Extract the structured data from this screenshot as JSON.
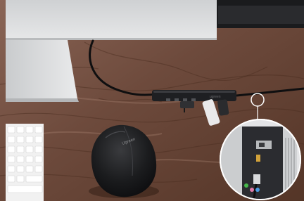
{
  "scene": {
    "description_alt": "",
    "mouse": {
      "brand_text": "Ugreen"
    },
    "hub": {
      "brand_text": "ugreen"
    },
    "colors": {
      "wood_dark": "#5a3a2a",
      "wood_mid": "#7a5545",
      "wood_light": "#9c7766",
      "monitor_stand": "#d8dadc",
      "hub": "#1e1f22",
      "mouse": "#17181a",
      "keyboard": "#f3f3f3",
      "tower": "#d9dbdd"
    }
  }
}
